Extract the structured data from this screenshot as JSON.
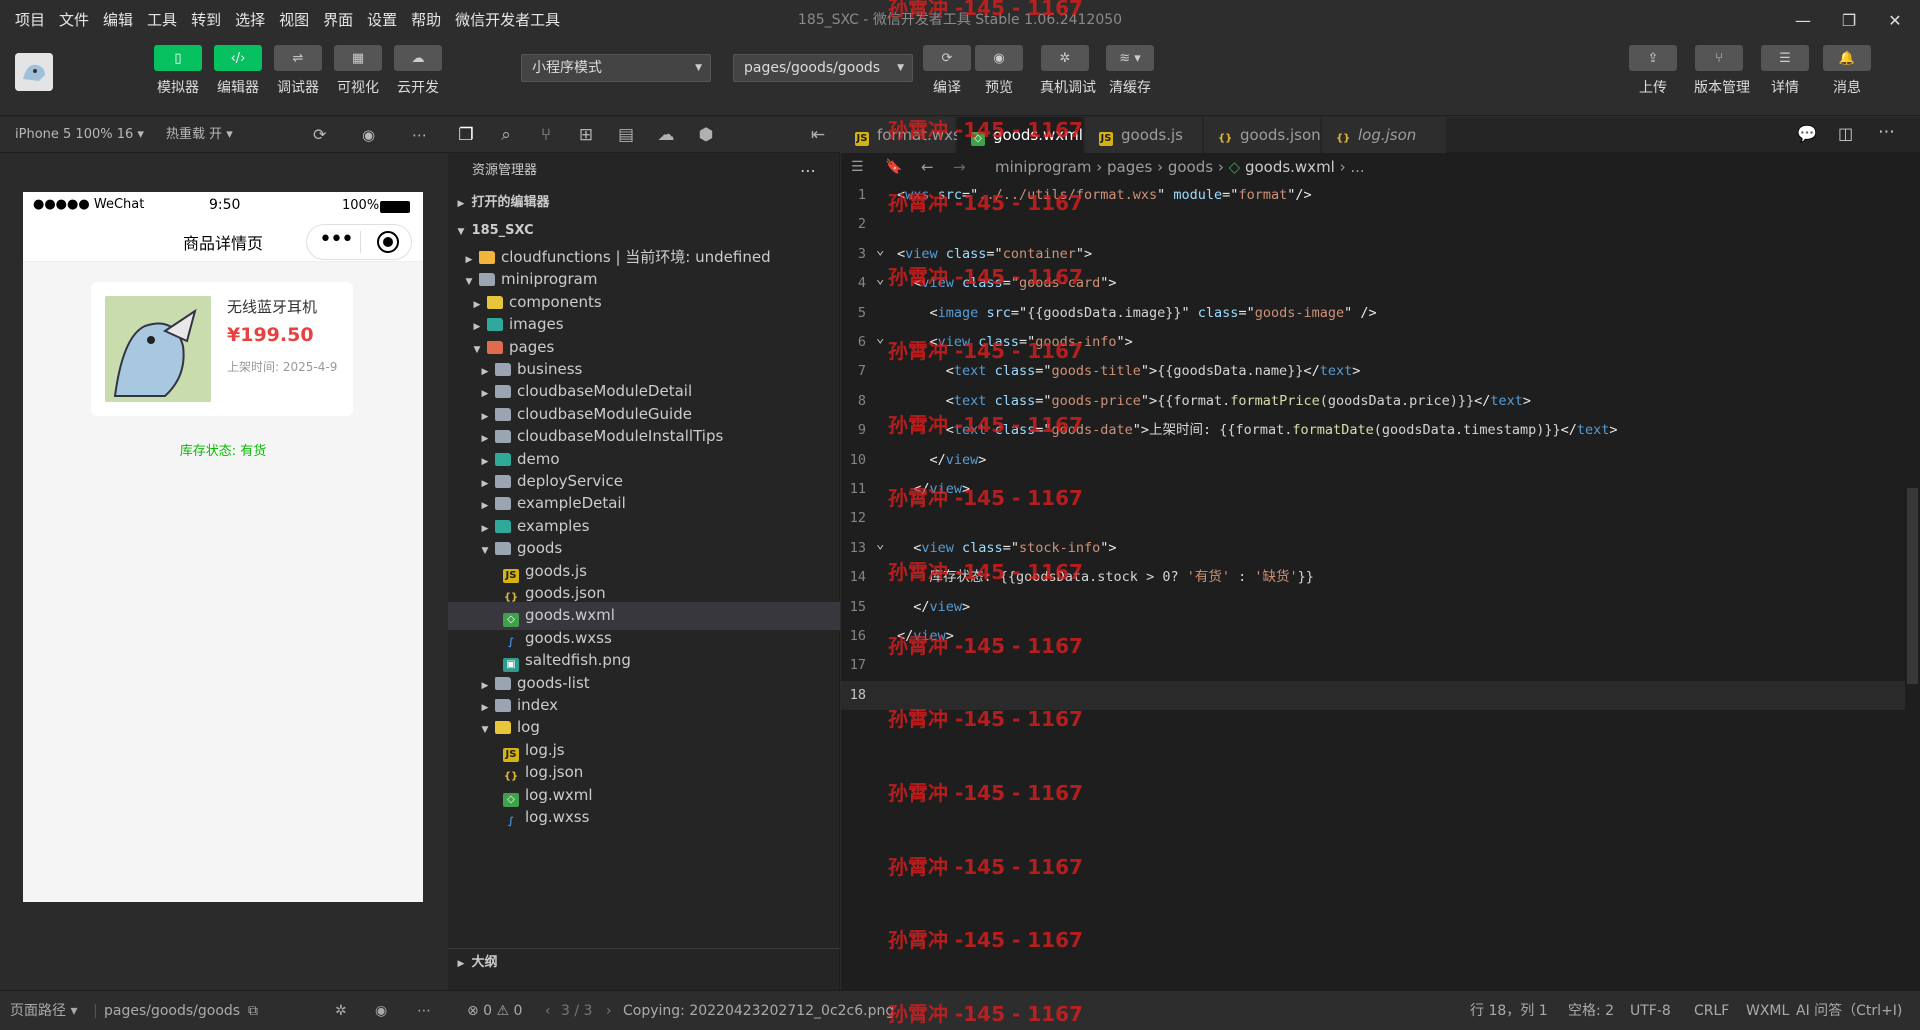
{
  "menu": [
    "项目",
    "文件",
    "编辑",
    "工具",
    "转到",
    "选择",
    "视图",
    "界面",
    "设置",
    "帮助",
    "微信开发者工具"
  ],
  "window_title": "185_SXC - 微信开发者工具 Stable 1.06.2412050",
  "toolbar": {
    "left_buttons": [
      {
        "label": "模拟器",
        "icon": "phone-icon"
      },
      {
        "label": "编辑器",
        "icon": "code-icon"
      },
      {
        "label": "调试器",
        "icon": "debug-icon"
      },
      {
        "label": "可视化",
        "icon": "layout-icon"
      },
      {
        "label": "云开发",
        "icon": "cloud-icon"
      }
    ],
    "mode_select": "小程序模式",
    "path_select": "pages/goods/goods",
    "mid_buttons": [
      {
        "label": "编译",
        "icon": "refresh-icon"
      },
      {
        "label": "预览",
        "icon": "eye-icon"
      },
      {
        "label": "真机调试",
        "icon": "bug-icon"
      },
      {
        "label": "清缓存",
        "icon": "layers-icon"
      }
    ],
    "right_buttons": [
      {
        "label": "上传",
        "icon": "upload-icon"
      },
      {
        "label": "版本管理",
        "icon": "branch-icon"
      },
      {
        "label": "详情",
        "icon": "menu-icon"
      },
      {
        "label": "消息",
        "icon": "bell-icon"
      }
    ]
  },
  "simulator": {
    "device": "iPhone 5 100% 16",
    "hot_reload": "热重载 开",
    "status_carrier": "●●●●● WeChat",
    "status_time": "9:50",
    "status_battery": "100%",
    "nav_title": "商品详情页",
    "goods_name": "无线蓝牙耳机",
    "goods_price": "¥199.50",
    "goods_date": "上架时间: 2025-4-9",
    "stock": "库存状态: 有货"
  },
  "explorer": {
    "title": "资源管理器",
    "open_editors": "打开的编辑器",
    "project": "185_SXC",
    "outline": "大纲",
    "tree": [
      {
        "label": "cloudfunctions | 当前环境: undefined",
        "depth": 1,
        "arrow": "▶",
        "icon": "folder-cloud"
      },
      {
        "label": "miniprogram",
        "depth": 1,
        "arrow": "▼",
        "icon": "folder-open"
      },
      {
        "label": "components",
        "depth": 2,
        "arrow": "▶",
        "icon": "folder-yellow"
      },
      {
        "label": "images",
        "depth": 2,
        "arrow": "▶",
        "icon": "folder-img"
      },
      {
        "label": "pages",
        "depth": 2,
        "arrow": "▼",
        "icon": "folder-red"
      },
      {
        "label": "business",
        "depth": 3,
        "arrow": "▶",
        "icon": "folder"
      },
      {
        "label": "cloudbaseModuleDetail",
        "depth": 3,
        "arrow": "▶",
        "icon": "folder"
      },
      {
        "label": "cloudbaseModuleGuide",
        "depth": 3,
        "arrow": "▶",
        "icon": "folder"
      },
      {
        "label": "cloudbaseModuleInstallTips",
        "depth": 3,
        "arrow": "▶",
        "icon": "folder"
      },
      {
        "label": "demo",
        "depth": 3,
        "arrow": "▶",
        "icon": "folder-img"
      },
      {
        "label": "deployService",
        "depth": 3,
        "arrow": "▶",
        "icon": "folder"
      },
      {
        "label": "exampleDetail",
        "depth": 3,
        "arrow": "▶",
        "icon": "folder"
      },
      {
        "label": "examples",
        "depth": 3,
        "arrow": "▶",
        "icon": "folder-img"
      },
      {
        "label": "goods",
        "depth": 3,
        "arrow": "▼",
        "icon": "folder-open"
      },
      {
        "label": "goods.js",
        "depth": 4,
        "arrow": "",
        "icon": "js"
      },
      {
        "label": "goods.json",
        "depth": 4,
        "arrow": "",
        "icon": "json"
      },
      {
        "label": "goods.wxml",
        "depth": 4,
        "arrow": "",
        "icon": "wxml",
        "selected": true
      },
      {
        "label": "goods.wxss",
        "depth": 4,
        "arrow": "",
        "icon": "wxss"
      },
      {
        "label": "saltedfish.png",
        "depth": 4,
        "arrow": "",
        "icon": "png"
      },
      {
        "label": "goods-list",
        "depth": 3,
        "arrow": "▶",
        "icon": "folder"
      },
      {
        "label": "index",
        "depth": 3,
        "arrow": "▶",
        "icon": "folder"
      },
      {
        "label": "log",
        "depth": 3,
        "arrow": "▼",
        "icon": "folder-open-yellow"
      },
      {
        "label": "log.js",
        "depth": 4,
        "arrow": "",
        "icon": "js"
      },
      {
        "label": "log.json",
        "depth": 4,
        "arrow": "",
        "icon": "json"
      },
      {
        "label": "log.wxml",
        "depth": 4,
        "arrow": "",
        "icon": "wxml"
      },
      {
        "label": "log.wxss",
        "depth": 4,
        "arrow": "",
        "icon": "wxss"
      }
    ]
  },
  "tabs": [
    {
      "label": "format.wxs",
      "icon": "js",
      "active": false
    },
    {
      "label": "goods.wxml",
      "icon": "wxml",
      "active": true
    },
    {
      "label": "goods.js",
      "icon": "js",
      "active": false
    },
    {
      "label": "goods.json",
      "icon": "json",
      "active": false
    },
    {
      "label": "log.json",
      "icon": "json",
      "active": false
    }
  ],
  "breadcrumb": [
    "miniprogram",
    "pages",
    "goods",
    "goods.wxml",
    "..."
  ],
  "code_lines": [
    [
      [
        "t-br",
        "<"
      ],
      [
        "t-tag",
        "wxs "
      ],
      [
        "t-attr",
        "src"
      ],
      [
        "t-br",
        "=\""
      ],
      [
        "t-str",
        "../../utils/format.wxs"
      ],
      [
        "t-br",
        "\" "
      ],
      [
        "t-attr",
        "module"
      ],
      [
        "t-br",
        "=\""
      ],
      [
        "t-str",
        "format"
      ],
      [
        "t-br",
        "\"/>"
      ]
    ],
    [],
    [
      [
        "t-br",
        "<"
      ],
      [
        "t-tag",
        "view "
      ],
      [
        "t-attr",
        "class"
      ],
      [
        "t-br",
        "=\""
      ],
      [
        "t-str",
        "container"
      ],
      [
        "t-br",
        "\">"
      ]
    ],
    [
      [
        "t-txt",
        "  "
      ],
      [
        "t-br",
        "<"
      ],
      [
        "t-tag",
        "view "
      ],
      [
        "t-attr",
        "class"
      ],
      [
        "t-br",
        "=\""
      ],
      [
        "t-str",
        "goods-card"
      ],
      [
        "t-br",
        "\">"
      ]
    ],
    [
      [
        "t-txt",
        "    "
      ],
      [
        "t-br",
        "<"
      ],
      [
        "t-tag",
        "image "
      ],
      [
        "t-attr",
        "src"
      ],
      [
        "t-br",
        "=\""
      ],
      [
        "t-txt",
        "{{goodsData.image}}"
      ],
      [
        "t-br",
        "\" "
      ],
      [
        "t-attr",
        "class"
      ],
      [
        "t-br",
        "=\""
      ],
      [
        "t-str",
        "goods-image"
      ],
      [
        "t-br",
        "\" />"
      ]
    ],
    [
      [
        "t-txt",
        "    "
      ],
      [
        "t-br",
        "<"
      ],
      [
        "t-tag",
        "view "
      ],
      [
        "t-attr",
        "class"
      ],
      [
        "t-br",
        "=\""
      ],
      [
        "t-str",
        "goods-info"
      ],
      [
        "t-br",
        "\">"
      ]
    ],
    [
      [
        "t-txt",
        "      "
      ],
      [
        "t-br",
        "<"
      ],
      [
        "t-tag",
        "text "
      ],
      [
        "t-attr",
        "class"
      ],
      [
        "t-br",
        "=\""
      ],
      [
        "t-str",
        "goods-title"
      ],
      [
        "t-br",
        "\">"
      ],
      [
        "t-txt",
        "{{goodsData.name}}"
      ],
      [
        "t-br",
        "</"
      ],
      [
        "t-tag",
        "text"
      ],
      [
        "t-br",
        ">"
      ]
    ],
    [
      [
        "t-txt",
        "      "
      ],
      [
        "t-br",
        "<"
      ],
      [
        "t-tag",
        "text "
      ],
      [
        "t-attr",
        "class"
      ],
      [
        "t-br",
        "=\""
      ],
      [
        "t-str",
        "goods-price"
      ],
      [
        "t-br",
        "\">"
      ],
      [
        "t-txt",
        "{{format."
      ],
      [
        "t-fn",
        "formatPrice"
      ],
      [
        "t-txt",
        "(goodsData.price)}}"
      ],
      [
        "t-br",
        "</"
      ],
      [
        "t-tag",
        "text"
      ],
      [
        "t-br",
        ">"
      ]
    ],
    [
      [
        "t-txt",
        "      "
      ],
      [
        "t-br",
        "<"
      ],
      [
        "t-tag",
        "text "
      ],
      [
        "t-attr",
        "class"
      ],
      [
        "t-br",
        "=\""
      ],
      [
        "t-str",
        "goods-date"
      ],
      [
        "t-br",
        "\">"
      ],
      [
        "t-txt",
        "上架时间: {{format."
      ],
      [
        "t-fn",
        "formatDate"
      ],
      [
        "t-txt",
        "(goodsData.timestamp)}}"
      ],
      [
        "t-br",
        "</"
      ],
      [
        "t-tag",
        "text"
      ],
      [
        "t-br",
        ">"
      ]
    ],
    [
      [
        "t-txt",
        "    "
      ],
      [
        "t-br",
        "</"
      ],
      [
        "t-tag",
        "view"
      ],
      [
        "t-br",
        ">"
      ]
    ],
    [
      [
        "t-txt",
        "  "
      ],
      [
        "t-br",
        "</"
      ],
      [
        "t-tag",
        "view"
      ],
      [
        "t-br",
        ">"
      ]
    ],
    [],
    [
      [
        "t-txt",
        "  "
      ],
      [
        "t-br",
        "<"
      ],
      [
        "t-tag",
        "view "
      ],
      [
        "t-attr",
        "class"
      ],
      [
        "t-br",
        "=\""
      ],
      [
        "t-str",
        "stock-info"
      ],
      [
        "t-br",
        "\">"
      ]
    ],
    [
      [
        "t-txt",
        "    库存状态: {{goodsData.stock > 0? "
      ],
      [
        "t-str",
        "'有货'"
      ],
      [
        "t-txt",
        " : "
      ],
      [
        "t-str",
        "'缺货'"
      ],
      [
        "t-txt",
        "}}"
      ]
    ],
    [
      [
        "t-txt",
        "  "
      ],
      [
        "t-br",
        "</"
      ],
      [
        "t-tag",
        "view"
      ],
      [
        "t-br",
        ">"
      ]
    ],
    [
      [
        "t-br",
        "</"
      ],
      [
        "t-tag",
        "view"
      ],
      [
        "t-br",
        ">"
      ]
    ],
    [],
    []
  ],
  "watermark": "孙霄冲 -145 - 1167",
  "statusbar": {
    "page_path_label": "页面路径",
    "page_path": "pages/goods/goods",
    "errors": "⊗ 0 ⚠ 0",
    "nav": "3 / 3",
    "copying": "Copying: 20220423202712_0c2c6.png",
    "cursor": "行 18，列 1",
    "spaces": "空格: 2",
    "encoding": "UTF-8",
    "eol": "CRLF",
    "lang": "WXML",
    "ai": "AI 问答（Ctrl+I)"
  },
  "colors": {
    "accent": "#07c160",
    "price": "#e64340",
    "stock": "#09bb07"
  }
}
